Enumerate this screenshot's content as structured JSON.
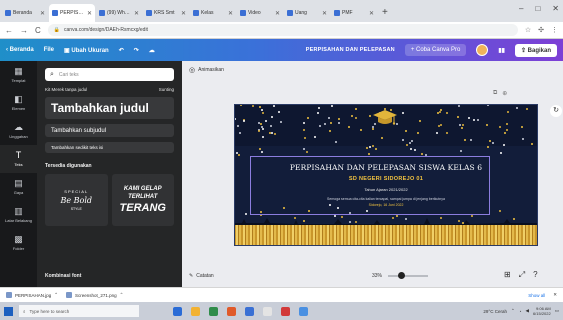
{
  "browser": {
    "tabs": [
      {
        "label": "Beranda",
        "active": false
      },
      {
        "label": "PERPISAHAN",
        "active": true
      },
      {
        "label": "(99) WhatsApp",
        "active": false
      },
      {
        "label": "KRS Smt",
        "active": false
      },
      {
        "label": "Kelas",
        "active": false
      },
      {
        "label": "Video",
        "active": false
      },
      {
        "label": "Uang",
        "active": false
      },
      {
        "label": "PMF",
        "active": false
      }
    ],
    "new_tab": "+",
    "url": "canva.com/design/DAEh-Rsmcxg/edit",
    "nav": {
      "back": "←",
      "forward": "→",
      "reload": "C"
    }
  },
  "canva_header": {
    "home": "Beranda",
    "file": "File",
    "resize": "Ubah Ukuran",
    "undo": "↶",
    "redo": "↷",
    "document_title": "PERPISAHAN DAN PELEPASAN",
    "upgrade": "+ Coba Canva Pro",
    "share": "Bagikan"
  },
  "sidebar": {
    "items": [
      {
        "icon": "▦",
        "label": "Templat",
        "icon_name": "template-icon"
      },
      {
        "icon": "◧",
        "label": "Elemen",
        "icon_name": "elements-icon"
      },
      {
        "icon": "☁",
        "label": "Unggahan",
        "icon_name": "uploads-icon"
      },
      {
        "icon": "T",
        "label": "Teks",
        "icon_name": "text-icon"
      },
      {
        "icon": "▤",
        "label": "Gaya",
        "icon_name": "styles-icon"
      },
      {
        "icon": "▥",
        "label": "Latar Belakang",
        "icon_name": "background-icon"
      },
      {
        "icon": "▩",
        "label": "Folder",
        "icon_name": "folder-icon"
      }
    ]
  },
  "text_panel": {
    "search_placeholder": "Cari teks",
    "brand_kit": "Kit Merek tanpa judul",
    "edit": "Sunting",
    "add_heading": "Tambahkan judul",
    "add_subheading": "Tambahkan subjudul",
    "add_body": "Tambahkan sedikit teks isi",
    "section_title": "Tersedia digunakan",
    "combo1": {
      "line1": "SPECIAL",
      "line2": "Be Bold",
      "line3": "STYLE"
    },
    "combo2": {
      "line1": "KAMI GELAP",
      "line2": "TERLIHAT",
      "line3": "TERANG"
    },
    "font_combinations": "Kombinasi font"
  },
  "workspace": {
    "animate": "Animasikan",
    "design": {
      "title": "PERPISAHAN DAN PELEPASAN SISWA KELAS 6",
      "school": "SD NEGERI SIDOREJO 01",
      "year": "Tahun Ajaran 2021/2022",
      "note": "Semoga semua cita-cita kalian tercapai, sampai jumpa di jenjang berikutnya",
      "date": "Sidorejo, 16 Juni 2022"
    },
    "notes": "Catatan",
    "zoom": {
      "percent_label": "33%",
      "value": 0.33
    }
  },
  "downloads": {
    "items": [
      {
        "name": "PERPISAHAN.jpg"
      },
      {
        "name": "Screenshot_271.png"
      }
    ],
    "show_all": "Show all"
  },
  "taskbar": {
    "search_placeholder": "Type here to search",
    "tray_text": "29°C Cerah",
    "time": "9:06 AM",
    "date": "6/15/2022",
    "app_colors": [
      "#2b6cd6",
      "#f2b233",
      "#2f8c4a",
      "#e05a2a",
      "#3a70d4",
      "#e4e4e4",
      "#d23a3a",
      "#4a90e2"
    ]
  },
  "colors": {
    "canvas_bg": "#121d3a",
    "gold": "#f3c440",
    "panel": "#252627",
    "rail": "#18191b"
  }
}
